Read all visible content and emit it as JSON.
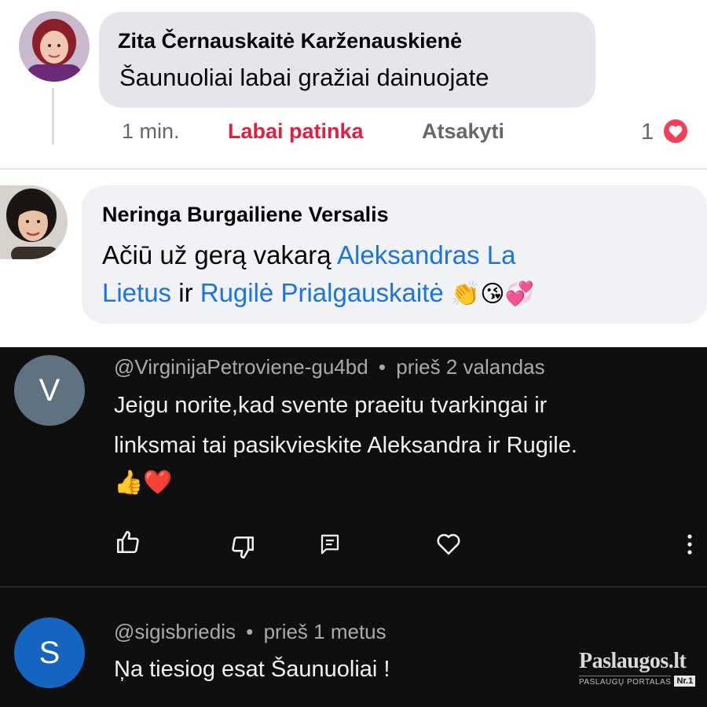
{
  "facebook": {
    "comments": [
      {
        "author": "Zita Černauskaitė Karženauskienė",
        "text": "Šaunuoliai labai gražiai dainuojate",
        "time": "1 min.",
        "reaction_label": "Labai patinka",
        "reply_label": "Atsakyti",
        "reaction_count": "1"
      },
      {
        "author": "Neringa Burgailiene Versalis",
        "text_line1_plain": "Ačiū už gerą vakarą ",
        "mention1_part1": "Aleksandras La",
        "mention1_part2": "Lietus",
        "conjunction": " ir ",
        "mention2": "Rugilė Prialgauskaitė",
        "emojis": "👏😘💞"
      }
    ],
    "colors": {
      "link": "#1b74e4",
      "love": "#e41e3f"
    }
  },
  "youtube": {
    "comments": [
      {
        "avatar_letter": "V",
        "avatar_color": "#5f7281",
        "handle": "@VirginijaPetroviene-gu4bd",
        "time": "prieš 2 valandas",
        "separator": "•",
        "line1": "Jeigu norite,kad svente praeitu tvarkingai ir",
        "line2": "linksmai tai pasikvieskite Aleksandra ir Rugile.",
        "emojis": "👍❤️"
      },
      {
        "avatar_letter": "S",
        "avatar_color": "#1565c0",
        "handle": "@sigisbriedis",
        "time": "prieš 1 metus",
        "separator": "•",
        "line1": "Ņa tiesiog esat Šaunuoliai !"
      }
    ],
    "actions": [
      "like-icon",
      "dislike-icon",
      "reply-icon",
      "heart-icon",
      "more-icon"
    ]
  },
  "watermark": {
    "title": "Paslaugos.lt",
    "subtitle": "PASLAUGŲ PORTALAS",
    "badge": "Nr.1"
  }
}
